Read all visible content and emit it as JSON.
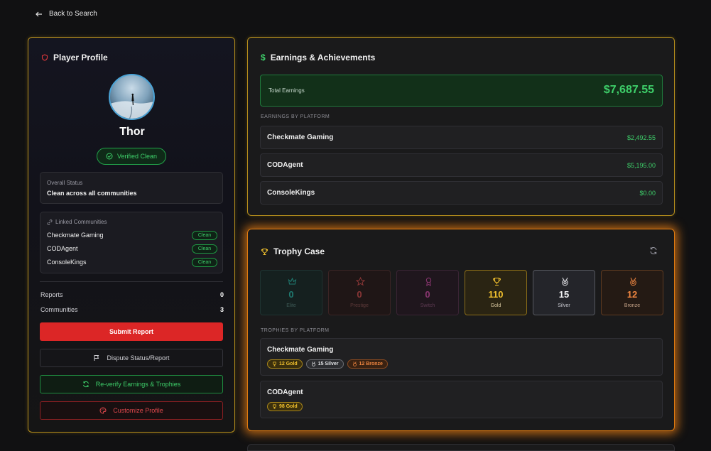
{
  "nav": {
    "back_label": "Back to Search"
  },
  "profile": {
    "title": "Player Profile",
    "name": "Thor",
    "verified_label": "Verified Clean",
    "status_label": "Overall Status",
    "status_value": "Clean across all communities",
    "linked_label": "Linked Communities",
    "linked": [
      {
        "name": "Checkmate Gaming",
        "status": "Clean"
      },
      {
        "name": "CODAgent",
        "status": "Clean"
      },
      {
        "name": "ConsoleKings",
        "status": "Clean"
      }
    ],
    "stats": [
      {
        "label": "Reports",
        "value": "0"
      },
      {
        "label": "Communities",
        "value": "3"
      }
    ],
    "buttons": {
      "submit": "Submit Report",
      "dispute": "Dispute Status/Report",
      "reverify": "Re-verify Earnings & Trophies",
      "customize": "Customize Profile"
    }
  },
  "earnings": {
    "title": "Earnings & Achievements",
    "total_label": "Total Earnings",
    "total_value": "$7,687.55",
    "by_platform_label": "EARNINGS BY PLATFORM",
    "platforms": [
      {
        "name": "Checkmate Gaming",
        "amount": "$2,492.55"
      },
      {
        "name": "CODAgent",
        "amount": "$5,195.00"
      },
      {
        "name": "ConsoleKings",
        "amount": "$0.00"
      }
    ]
  },
  "trophies": {
    "title": "Trophy Case",
    "tiers": [
      {
        "label": "Elite",
        "count": "0",
        "icon": "crown-icon"
      },
      {
        "label": "Prestige",
        "count": "0",
        "icon": "star-icon"
      },
      {
        "label": "Switch",
        "count": "0",
        "icon": "award-icon"
      },
      {
        "label": "Gold",
        "count": "110",
        "icon": "trophy-icon"
      },
      {
        "label": "Silver",
        "count": "15",
        "icon": "medal-icon"
      },
      {
        "label": "Bronze",
        "count": "12",
        "icon": "medal-icon"
      }
    ],
    "by_platform_label": "TROPHIES BY PLATFORM",
    "platforms": [
      {
        "name": "Checkmate Gaming",
        "badges": {
          "gold": "12 Gold",
          "silver": "15 Silver",
          "bronze": "12 Bronze"
        }
      },
      {
        "name": "CODAgent",
        "badges": {
          "gold": "98 Gold"
        }
      }
    ]
  },
  "colors": {
    "accent_gold": "#b8901c",
    "success": "#3ecf6a",
    "danger": "#dc2626",
    "glow_orange": "#e07b10"
  }
}
